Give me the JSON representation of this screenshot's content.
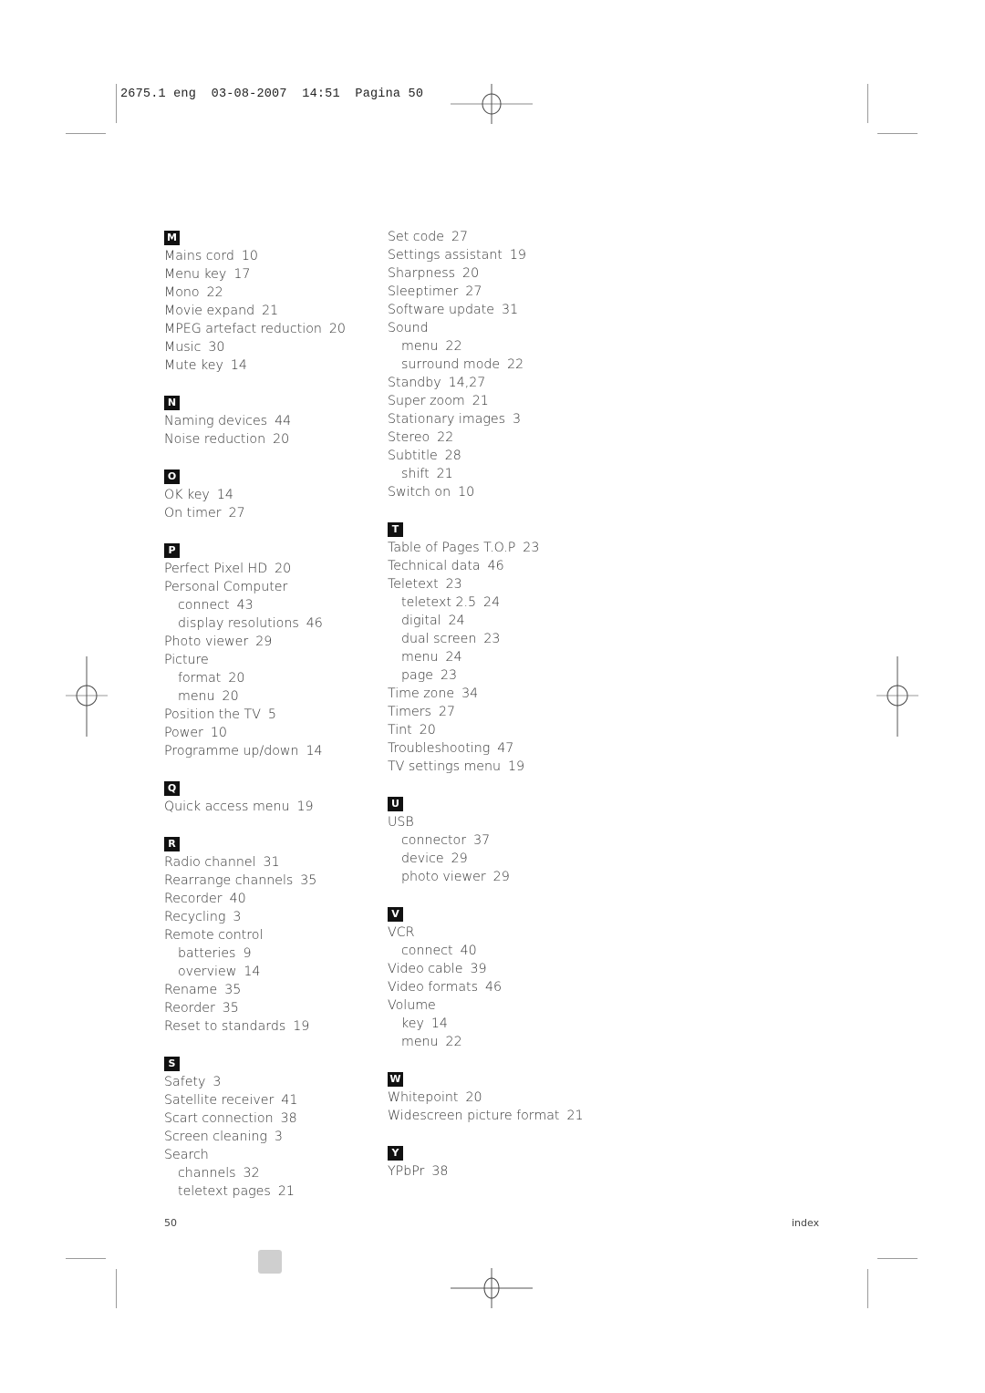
{
  "slug": {
    "job": "2675.1",
    "lang": "eng",
    "date": "03-08-2007",
    "time": "14:51",
    "page_label": "Pagina",
    "page_num": "50"
  },
  "left_column": [
    {
      "letter": "M",
      "entries": [
        {
          "term": "Mains cord",
          "pages": "10"
        },
        {
          "term": "Menu key",
          "pages": "17"
        },
        {
          "term": "Mono",
          "pages": "22"
        },
        {
          "term": "Movie expand",
          "pages": "21"
        },
        {
          "term": "MPEG artefact reduction",
          "pages": "20"
        },
        {
          "term": "Music",
          "pages": "30"
        },
        {
          "term": "Mute key",
          "pages": "14"
        }
      ]
    },
    {
      "letter": "N",
      "entries": [
        {
          "term": "Naming devices",
          "pages": "44"
        },
        {
          "term": "Noise reduction",
          "pages": "20"
        }
      ]
    },
    {
      "letter": "O",
      "entries": [
        {
          "term": "OK key",
          "pages": "14"
        },
        {
          "term": "On timer",
          "pages": "27"
        }
      ]
    },
    {
      "letter": "P",
      "entries": [
        {
          "term": "Perfect Pixel HD",
          "pages": "20"
        },
        {
          "term": "Personal Computer",
          "pages": ""
        },
        {
          "term": "connect",
          "pages": "43",
          "sub": true
        },
        {
          "term": "display resolutions",
          "pages": "46",
          "sub": true
        },
        {
          "term": "Photo viewer",
          "pages": "29"
        },
        {
          "term": "Picture",
          "pages": ""
        },
        {
          "term": "format",
          "pages": "20",
          "sub": true
        },
        {
          "term": "menu",
          "pages": "20",
          "sub": true
        },
        {
          "term": "Position the TV",
          "pages": "5"
        },
        {
          "term": "Power",
          "pages": "10"
        },
        {
          "term": "Programme up/down",
          "pages": "14"
        }
      ]
    },
    {
      "letter": "Q",
      "entries": [
        {
          "term": "Quick access menu",
          "pages": "19"
        }
      ]
    },
    {
      "letter": "R",
      "entries": [
        {
          "term": "Radio channel",
          "pages": "31"
        },
        {
          "term": "Rearrange channels",
          "pages": "35"
        },
        {
          "term": "Recorder",
          "pages": "40"
        },
        {
          "term": "Recycling",
          "pages": "3"
        },
        {
          "term": "Remote control",
          "pages": ""
        },
        {
          "term": "batteries",
          "pages": "9",
          "sub": true
        },
        {
          "term": "overview",
          "pages": "14",
          "sub": true
        },
        {
          "term": "Rename",
          "pages": "35"
        },
        {
          "term": "Reorder",
          "pages": "35"
        },
        {
          "term": "Reset to standards",
          "pages": "19"
        }
      ]
    },
    {
      "letter": "S",
      "entries": [
        {
          "term": "Safety",
          "pages": "3"
        },
        {
          "term": "Satellite receiver",
          "pages": "41"
        },
        {
          "term": "Scart connection",
          "pages": "38"
        },
        {
          "term": "Screen cleaning",
          "pages": "3"
        },
        {
          "term": "Search",
          "pages": ""
        },
        {
          "term": "channels",
          "pages": "32",
          "sub": true
        },
        {
          "term": "teletext pages",
          "pages": "21",
          "sub": true
        }
      ]
    }
  ],
  "right_column": [
    {
      "letter": "",
      "entries": [
        {
          "term": "Set code",
          "pages": "27"
        },
        {
          "term": "Settings assistant",
          "pages": "19"
        },
        {
          "term": "Sharpness",
          "pages": "20"
        },
        {
          "term": "Sleeptimer",
          "pages": "27"
        },
        {
          "term": "Software update",
          "pages": "31"
        },
        {
          "term": "Sound",
          "pages": ""
        },
        {
          "term": "menu",
          "pages": "22",
          "sub": true
        },
        {
          "term": "surround mode",
          "pages": "22",
          "sub": true
        },
        {
          "term": "Standby",
          "pages": "14,27"
        },
        {
          "term": "Super zoom",
          "pages": "21"
        },
        {
          "term": "Stationary images",
          "pages": "3"
        },
        {
          "term": "Stereo",
          "pages": "22"
        },
        {
          "term": "Subtitle",
          "pages": "28"
        },
        {
          "term": "shift",
          "pages": "21",
          "sub": true
        },
        {
          "term": "Switch on",
          "pages": "10"
        }
      ]
    },
    {
      "letter": "T",
      "entries": [
        {
          "term": "Table of Pages T.O.P",
          "pages": "23"
        },
        {
          "term": "Technical data",
          "pages": "46"
        },
        {
          "term": "Teletext",
          "pages": "23"
        },
        {
          "term": "teletext 2.5",
          "pages": "24",
          "sub": true
        },
        {
          "term": "digital",
          "pages": "24",
          "sub": true
        },
        {
          "term": "dual screen",
          "pages": "23",
          "sub": true
        },
        {
          "term": "menu",
          "pages": "24",
          "sub": true
        },
        {
          "term": "page",
          "pages": "23",
          "sub": true
        },
        {
          "term": "Time zone",
          "pages": "34"
        },
        {
          "term": "Timers",
          "pages": "27"
        },
        {
          "term": "Tint",
          "pages": "20"
        },
        {
          "term": "Troubleshooting",
          "pages": "47"
        },
        {
          "term": "TV settings menu",
          "pages": "19"
        }
      ]
    },
    {
      "letter": "U",
      "entries": [
        {
          "term": "USB",
          "pages": ""
        },
        {
          "term": "connector",
          "pages": "37",
          "sub": true
        },
        {
          "term": "device",
          "pages": "29",
          "sub": true
        },
        {
          "term": "photo viewer",
          "pages": "29",
          "sub": true
        }
      ]
    },
    {
      "letter": "V",
      "entries": [
        {
          "term": "VCR",
          "pages": ""
        },
        {
          "term": "connect",
          "pages": "40",
          "sub": true
        },
        {
          "term": "Video cable",
          "pages": "39"
        },
        {
          "term": "Video formats",
          "pages": "46"
        },
        {
          "term": "Volume",
          "pages": ""
        },
        {
          "term": "key",
          "pages": "14",
          "sub": true
        },
        {
          "term": "menu",
          "pages": "22",
          "sub": true
        }
      ]
    },
    {
      "letter": "W",
      "entries": [
        {
          "term": "Whitepoint",
          "pages": "20"
        },
        {
          "term": "Widescreen picture format",
          "pages": "21"
        }
      ]
    },
    {
      "letter": "Y",
      "entries": [
        {
          "term": "YPbPr",
          "pages": "38"
        }
      ]
    }
  ],
  "footer": {
    "page_number": "50",
    "section": "index"
  }
}
